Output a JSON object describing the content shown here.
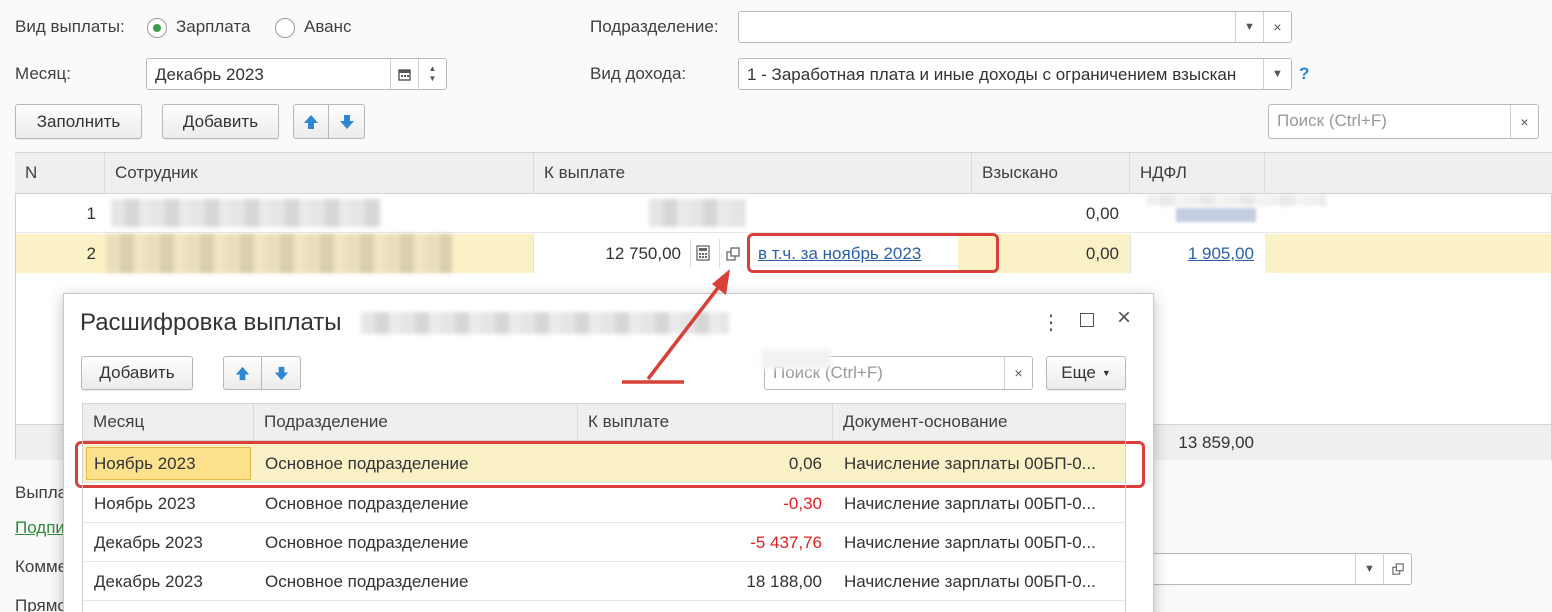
{
  "form": {
    "payment_type_label": "Вид выплаты:",
    "radio_salary": "Зарплата",
    "radio_advance": "Аванс",
    "department_label": "Подразделение:",
    "department_value": "",
    "month_label": "Месяц:",
    "month_value": "Декабрь 2023",
    "income_type_label": "Вид дохода:",
    "income_type_value": "1 - Заработная плата и иные доходы с ограничением взыскан",
    "help_mark": "?",
    "fill_button": "Заполнить",
    "add_button": "Добавить",
    "search_placeholder": "Поиск (Ctrl+F)"
  },
  "main_table": {
    "columns": [
      "N",
      "Сотрудник",
      "К выплате",
      "Взыскано",
      "НДФЛ"
    ],
    "rows": [
      {
        "n": "1",
        "payout": "",
        "recovered": "0,00",
        "ndfl": ""
      },
      {
        "n": "2",
        "payout": "12 750,00",
        "included_link": "в т.ч. за ноябрь 2023",
        "recovered": "0,00",
        "ndfl": "1 905,00"
      }
    ],
    "footer_total": "13 859,00"
  },
  "behind": {
    "text1": "Выпла",
    "text2": "Подпи",
    "text3": "Комме",
    "text4": "Прямо"
  },
  "dialog": {
    "title": "Расшифровка выплаты",
    "add_button": "Добавить",
    "search_placeholder": "Поиск (Ctrl+F)",
    "more_button": "Еще",
    "columns": [
      "Месяц",
      "Подразделение",
      "К выплате",
      "Документ-основание"
    ],
    "rows": [
      {
        "month": "Ноябрь 2023",
        "dept": "Основное подразделение",
        "amount": "0,06",
        "doc": "Начисление зарплаты 00БП-0..."
      },
      {
        "month": "Ноябрь 2023",
        "dept": "Основное подразделение",
        "amount": "-0,30",
        "doc": "Начисление зарплаты 00БП-0..."
      },
      {
        "month": "Декабрь 2023",
        "dept": "Основное подразделение",
        "amount": "-5 437,76",
        "doc": "Начисление зарплаты 00БП-0..."
      },
      {
        "month": "Декабрь 2023",
        "dept": "Основное подразделение",
        "amount": "18 188,00",
        "doc": "Начисление зарплаты 00БП-0..."
      }
    ]
  },
  "colors": {
    "selected_row": "#fbf1c7",
    "highlight": "#d9403a",
    "link": "#2a5fa8",
    "negative": "#e02020"
  }
}
